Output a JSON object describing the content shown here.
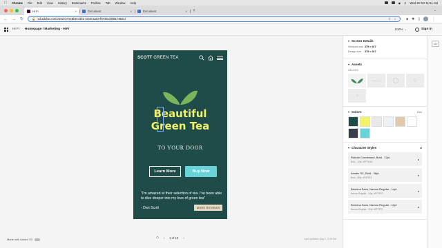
{
  "menubar": {
    "app": "Chrome",
    "items": [
      "File",
      "Edit",
      "View",
      "History",
      "Bookmarks",
      "Profiles",
      "Tab",
      "Window",
      "Help"
    ],
    "clock": "Wed 19 Oct 11:51 AM"
  },
  "tabs": [
    {
      "title": "Hi Fi",
      "active": true,
      "favicon_color": "#470137"
    },
    {
      "title": "Document",
      "active": false,
      "favicon_color": "#3a6fd8"
    },
    {
      "title": "Document",
      "active": false,
      "favicon_color": "#3a6fd8"
    }
  ],
  "address": {
    "url": "xd.adobe.com/view/ce72c8b5-ed61-43c8-aa63-f573bcd6f81f-8621/"
  },
  "xd": {
    "left_label": "Hi Fi",
    "breadcrumb": "Homepage / Marketing - HiFi",
    "zoom": "100%",
    "signin": "Sign in"
  },
  "artboard": {
    "logo_bold": "SCOTT",
    "logo_rest": " GREEN TEA",
    "title_line1": "Beautiful",
    "title_line2": "Green Tea",
    "subtitle": "TO YOUR DOOR",
    "btn_learn": "Learn More",
    "btn_buy": "Buy Now",
    "quote": "\"I'm amazed at their selection of tea. I've been able to dive deeper into my love of green tea\"",
    "author": "- Dan Scott",
    "more_reviews": "MORE REVIEWS",
    "bg_color": "#1f4b48",
    "accent": "#6ad2d9",
    "title_color": "#f2f36a"
  },
  "footer": {
    "made_with": "Made with Adobe XD",
    "page_indicator": "1 of 10",
    "last_updated": "Last updated: Aug 1, 4:35 AM"
  },
  "panel": {
    "screen_details": {
      "title": "Screen Details",
      "viewport_label": "Viewport size",
      "viewport_value": "375 × 667",
      "design_label": "Design size",
      "design_value": "375 × 667"
    },
    "assets": {
      "title": "Assets",
      "images_label": "IMAGES"
    },
    "colors": {
      "title": "Colors",
      "action": "Hex",
      "swatches": [
        "#1f4b48",
        "#f2f36a",
        "#e9e9e9",
        "#eef2f6",
        "#e3c9a8",
        "#ffffff",
        "#3a3f4b",
        "#6ad2d9"
      ]
    },
    "character_styles": {
      "title": "Character Styles",
      "items": [
        {
          "name": "Roboto Condensed, Bold - 12pt",
          "detail": "Bold - 12pt, #FFFCAA"
        },
        {
          "name": "Amatic SC, Bold - 38pt",
          "detail": "Bold - 38pt, #F3F3F3"
        },
        {
          "name": "Bennina Sans, Narrow Regular - 14pt",
          "detail": "Narrow Regular - 14pt, #FFFFFF"
        },
        {
          "name": "Bennina Sans, Narrow Regular - 12pt",
          "detail": "Narrow Regular - 12pt, #FFFFFF"
        }
      ]
    }
  }
}
